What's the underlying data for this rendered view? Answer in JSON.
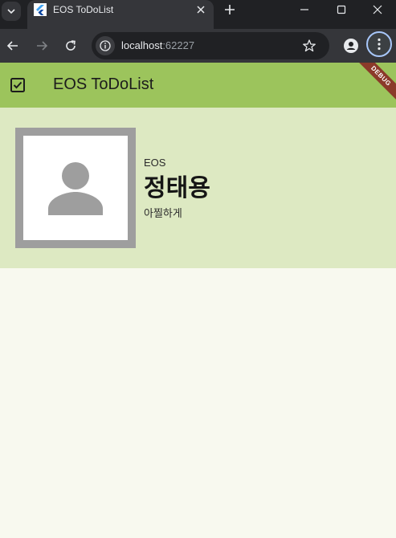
{
  "browser": {
    "tab_title": "EOS ToDoList",
    "url_host": "localhost",
    "url_port": ":62227",
    "icons": {
      "tab_search": "chevron-down-icon",
      "favicon": "flutter-icon",
      "tab_close": "close-icon",
      "new_tab": "plus-icon",
      "minimize": "minimize-icon",
      "maximize": "maximize-icon",
      "close_window": "close-icon",
      "back": "arrow-left-icon",
      "forward": "arrow-right-icon",
      "reload": "reload-icon",
      "site_info": "info-icon",
      "bookmark": "star-icon",
      "profile": "person-icon",
      "menu": "more-vert-icon"
    }
  },
  "app": {
    "title": "EOS ToDoList",
    "debug_banner": "DEBUG",
    "leading_icon": "checkbox-icon",
    "colors": {
      "appbar": "#9cc45c",
      "profile_card": "#dde9c2",
      "background": "#f8f9ef",
      "avatar_frame": "#9e9e9e",
      "avatar_icon": "#9e9e9e"
    },
    "profile": {
      "avatar_icon": "person-icon",
      "organization": "EOS",
      "name": "정태용",
      "motto": "아찔하게"
    }
  }
}
